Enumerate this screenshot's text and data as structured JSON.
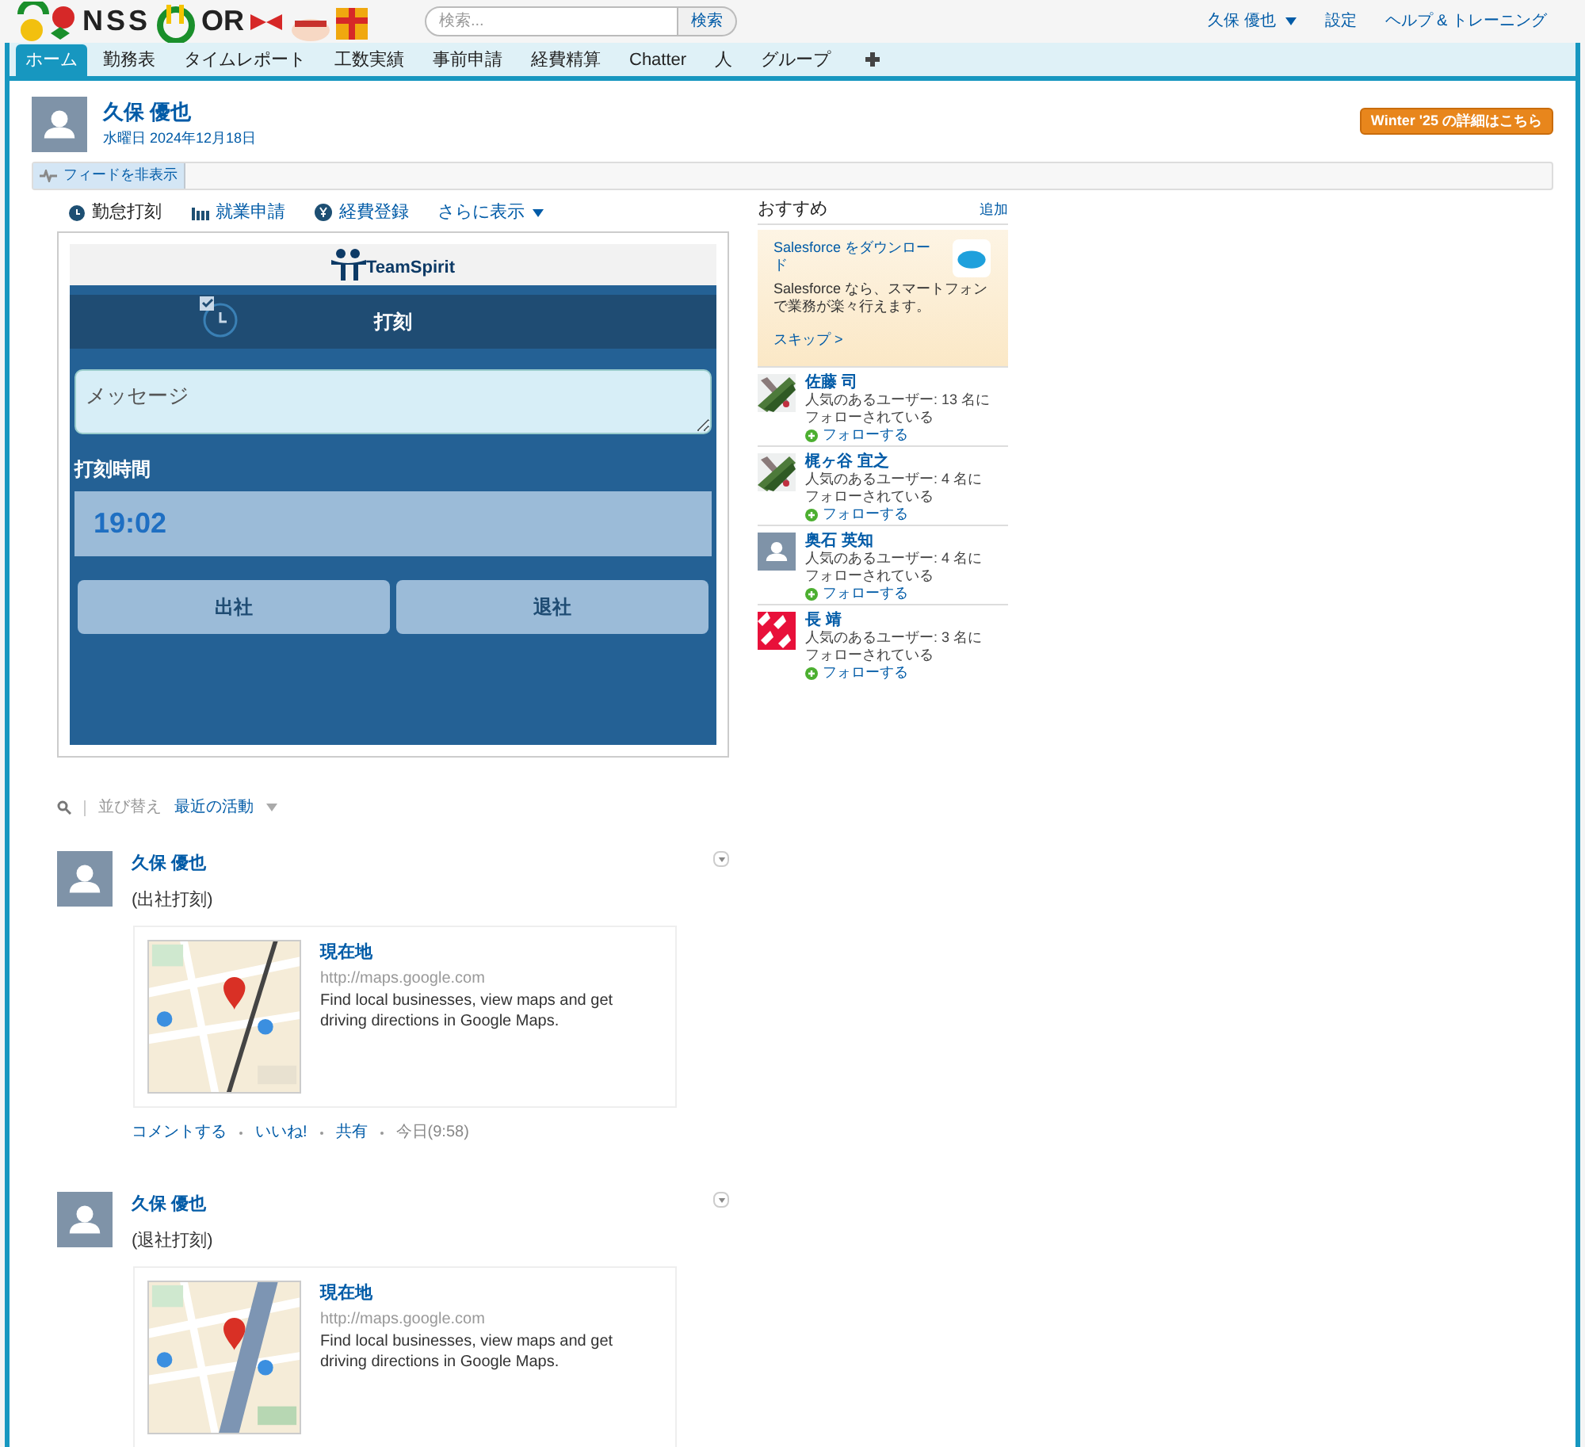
{
  "header": {
    "logo": [
      "NSS",
      "OR"
    ],
    "search": {
      "placeholder": "検索...",
      "button": "検索"
    },
    "user_menu": "久保 優也",
    "links": [
      "設定",
      "ヘルプ & トレーニング"
    ]
  },
  "tabs": [
    {
      "label": "ホーム",
      "selected": true
    },
    {
      "label": "勤務表",
      "selected": false
    },
    {
      "label": "タイムレポート",
      "selected": false
    },
    {
      "label": "工数実績",
      "selected": false
    },
    {
      "label": "事前申請",
      "selected": false
    },
    {
      "label": "経費精算",
      "selected": false
    },
    {
      "label": "Chatter",
      "selected": false
    },
    {
      "label": "人",
      "selected": false
    },
    {
      "label": "グループ",
      "selected": false
    }
  ],
  "profile": {
    "name": "久保 優也",
    "date": "水曜日 2024年12月18日",
    "promo_button": "Winter '25 の詳細はこちら"
  },
  "feed_toggle": "フィードを非表示",
  "publisher_tabs": [
    {
      "label": "勤怠打刻",
      "selected": true,
      "kind": "clock"
    },
    {
      "label": "就業申請",
      "selected": false,
      "kind": "bars"
    },
    {
      "label": "経費登録",
      "selected": false,
      "kind": "yen"
    }
  ],
  "publisher_more": "さらに表示",
  "punch_widget": {
    "brand": "TeamSpirit",
    "title": "打刻",
    "message_placeholder": "メッセージ",
    "time_label": "打刻時間",
    "time": "19:02",
    "buttons": [
      "出社",
      "退社"
    ]
  },
  "sort": {
    "label": "並び替え",
    "value": "最近の活動"
  },
  "posts": [
    {
      "author": "久保 優也",
      "body": "(出社打刻)",
      "link": {
        "title": "現在地",
        "url": "http://maps.google.com",
        "description": "Find local businesses, view maps and get driving directions in Google Maps."
      },
      "actions": [
        "コメントする",
        "いいね!",
        "共有"
      ],
      "time": "今日(9:58)"
    },
    {
      "author": "久保 優也",
      "body": "(退社打刻)",
      "link": {
        "title": "現在地",
        "url": "http://maps.google.com",
        "description": "Find local businesses, view maps and get driving directions in Google Maps."
      }
    }
  ],
  "recommendations": {
    "title": "おすすめ",
    "add": "追加",
    "promo": {
      "title": "Salesforce をダウンロード",
      "text": "Salesforce なら、スマートフォンで業務が楽々行えます。",
      "skip": "スキップ >"
    },
    "people": [
      {
        "name": "佐藤 司",
        "followers": "人気のあるユーザー: 13 名にフォローされている",
        "follow": "フォローする"
      },
      {
        "name": "梶ヶ谷 宜之",
        "followers": "人気のあるユーザー: 4 名にフォローされている",
        "follow": "フォローする"
      },
      {
        "name": "奥石 英知",
        "followers": "人気のあるユーザー: 4 名にフォローされている",
        "follow": "フォローする",
        "kind": "default"
      },
      {
        "name": "長 靖",
        "followers": "人気のあるユーザー: 3 名にフォローされている",
        "follow": "フォローする",
        "kind": "pattern"
      }
    ]
  }
}
